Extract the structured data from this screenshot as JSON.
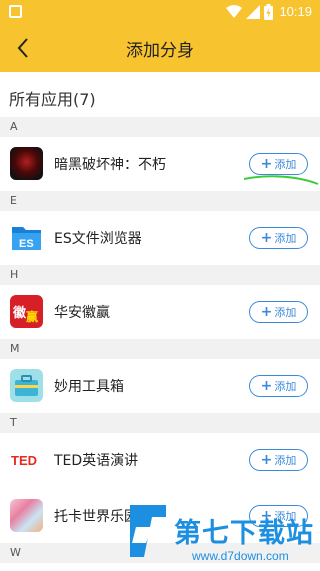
{
  "status_bar": {
    "time": "10:19"
  },
  "header": {
    "title": "添加分身"
  },
  "section": {
    "title": "所有应用(7)"
  },
  "groups": [
    {
      "letter": "A",
      "apps": [
        {
          "name": "暗黑破坏神：不朽",
          "add_label": "添加",
          "icon": "diablo-app-icon"
        }
      ]
    },
    {
      "letter": "E",
      "apps": [
        {
          "name": "ES文件浏览器",
          "add_label": "添加",
          "icon": "es-file-explorer-icon"
        }
      ]
    },
    {
      "letter": "H",
      "apps": [
        {
          "name": "华安徽赢",
          "add_label": "添加",
          "icon": "huaan-app-icon"
        }
      ]
    },
    {
      "letter": "M",
      "apps": [
        {
          "name": "妙用工具箱",
          "add_label": "添加",
          "icon": "toolbox-app-icon"
        }
      ]
    },
    {
      "letter": "T",
      "apps": [
        {
          "name": "TED英语演讲",
          "add_label": "添加",
          "icon": "ted-app-icon"
        },
        {
          "name": "托卡世界乐园",
          "add_label": "添加",
          "icon": "toca-world-icon"
        }
      ]
    },
    {
      "letter": "W",
      "apps": []
    }
  ],
  "watermark": {
    "brand": "第七下载站",
    "url": "www.d7down.com"
  },
  "colors": {
    "accent": "#f7c32e",
    "button": "#3b8ad9",
    "divider": "#f1f1f1"
  }
}
